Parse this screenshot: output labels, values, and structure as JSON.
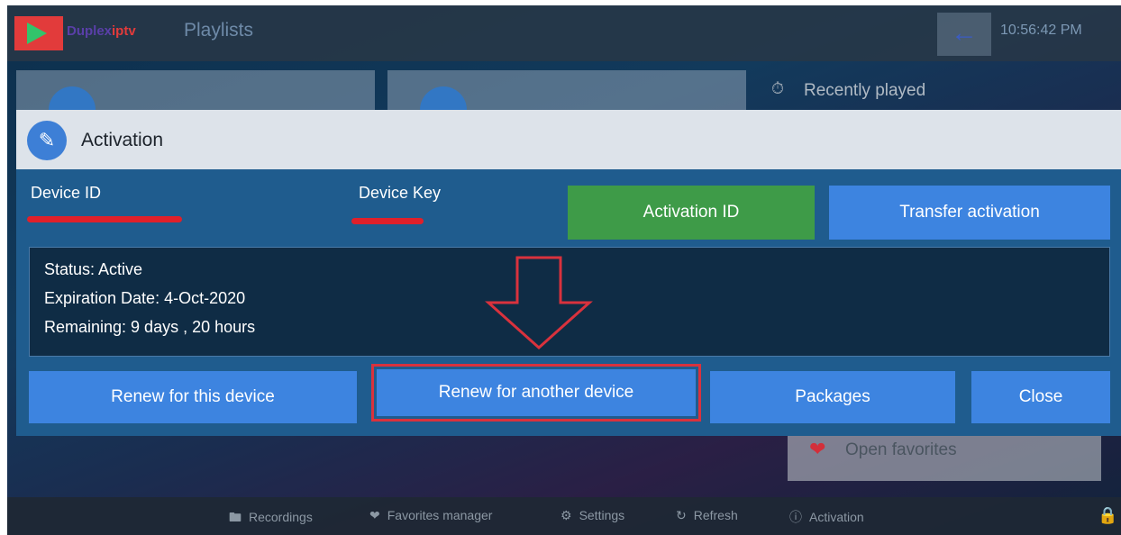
{
  "topbar": {
    "brand_part1": "Duplex",
    "brand_part2": "iptv",
    "title": "Playlists",
    "back_icon": "arrow-left-icon",
    "time": "10:56:42 PM"
  },
  "side": {
    "recently_played": "Recently played",
    "open_favorites": "Open favorites"
  },
  "bottombar": {
    "items": [
      {
        "label": "Recordings",
        "icon": "folder-icon"
      },
      {
        "label": "Favorites manager",
        "icon": "heart-icon"
      },
      {
        "label": "Settings",
        "icon": "gear-icon"
      },
      {
        "label": "Refresh",
        "icon": "refresh-icon"
      },
      {
        "label": "Activation",
        "icon": "info-icon"
      }
    ]
  },
  "dialog": {
    "title": "Activation",
    "device_id_label": "Device ID",
    "device_key_label": "Device Key",
    "activation_id_button": "Activation ID",
    "transfer_button": "Transfer activation",
    "status": "Status: Active",
    "expiration": "Expiration Date: 4-Oct-2020",
    "remaining": "Remaining: 9 days , 20 hours",
    "renew_this_button": "Renew for this device",
    "renew_another_button": "Renew for another device",
    "packages_button": "Packages",
    "close_button": "Close"
  },
  "colors": {
    "dialog_bg": "#1f5c8e",
    "button_blue": "#3d84e0",
    "button_green": "#3e9b48",
    "highlight_red": "#d9323d"
  }
}
